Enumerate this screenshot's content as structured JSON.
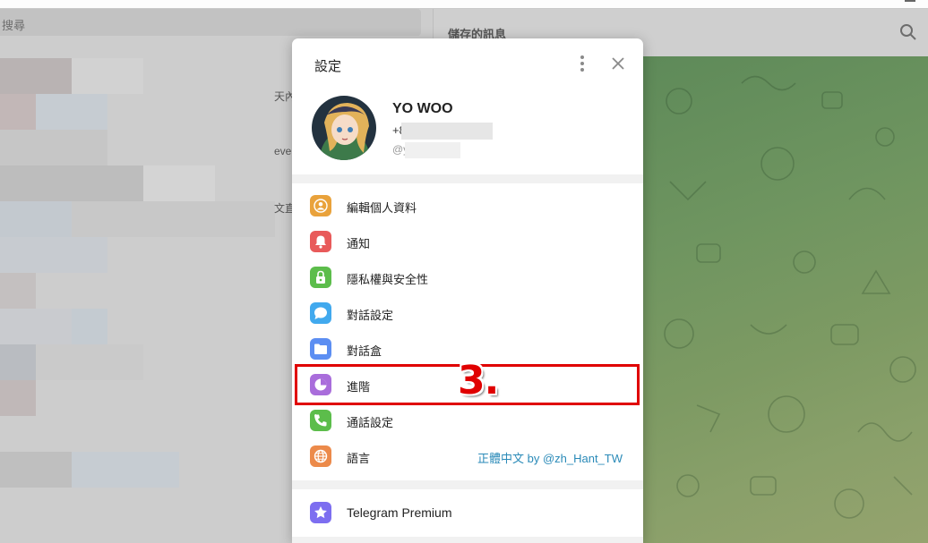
{
  "left_panel": {
    "search_placeholder": "搜尋",
    "fragments": [
      "天內",
      "eve",
      "文直"
    ]
  },
  "chat_header": {
    "title": "儲存的訊息"
  },
  "settings": {
    "title": "設定",
    "profile": {
      "name": "YO WOO",
      "phone": "+8",
      "handle": "@y"
    },
    "items": [
      {
        "label": "編輯個人資料",
        "icon": "person-icon",
        "color": "#e9a23b"
      },
      {
        "label": "通知",
        "icon": "bell-icon",
        "color": "#e85a5a"
      },
      {
        "label": "隱私權與安全性",
        "icon": "lock-icon",
        "color": "#5cbd4b"
      },
      {
        "label": "對話設定",
        "icon": "chat-bubble-icon",
        "color": "#41a9ee"
      },
      {
        "label": "對話盒",
        "icon": "folder-icon",
        "color": "#5c8ef2"
      },
      {
        "label": "進階",
        "icon": "pie-chart-icon",
        "color": "#a96ddb"
      },
      {
        "label": "通話設定",
        "icon": "phone-icon",
        "color": "#5cbd4b"
      },
      {
        "label": "語言",
        "icon": "globe-icon",
        "color": "#ec8a4a",
        "value": "正體中文 by @zh_Hant_TW"
      }
    ],
    "premium": {
      "label": "Telegram Premium",
      "icon": "star-icon",
      "color": "#7d6ef0"
    }
  },
  "annotation": {
    "step_label": "3."
  }
}
